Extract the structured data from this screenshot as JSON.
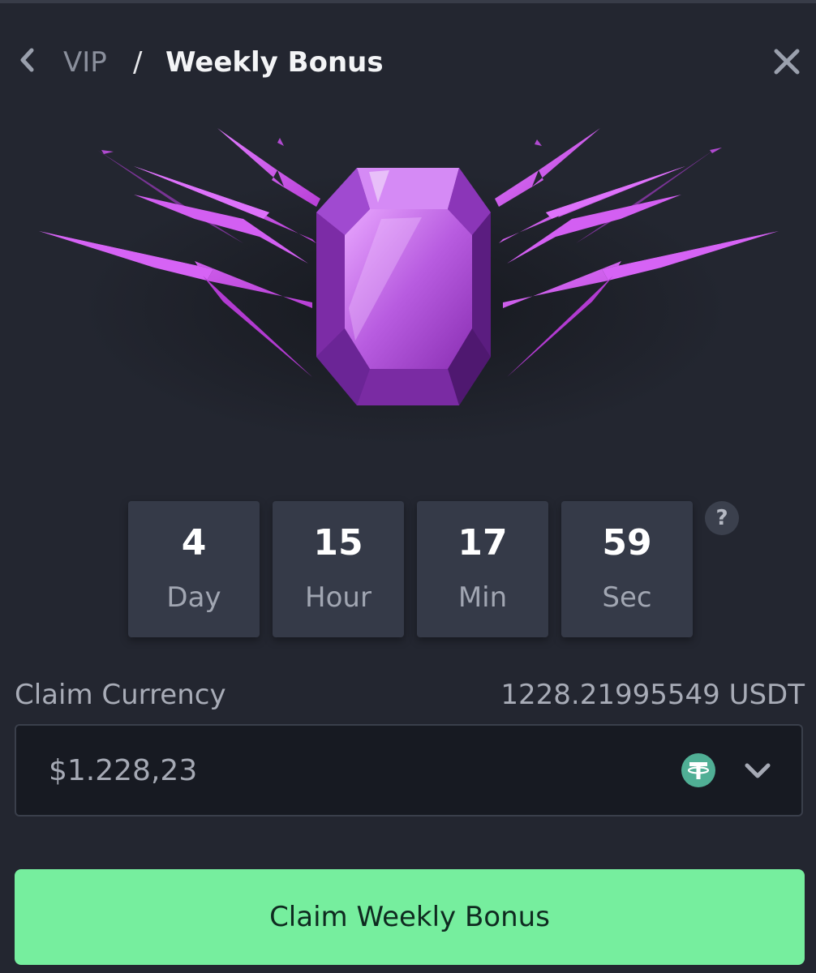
{
  "header": {
    "breadcrumb_parent": "VIP",
    "breadcrumb_separator": "/",
    "breadcrumb_current": "Weekly Bonus"
  },
  "hero": {
    "icon": "purple-gem-with-lightning-icon"
  },
  "countdown": [
    {
      "value": "4",
      "unit": "Day"
    },
    {
      "value": "15",
      "unit": "Hour"
    },
    {
      "value": "17",
      "unit": "Min"
    },
    {
      "value": "59",
      "unit": "Sec"
    }
  ],
  "help": {
    "label": "?"
  },
  "claim": {
    "label": "Claim Currency",
    "amount": "1228.21995549 USDT",
    "field_value": "$1.228,23",
    "currency_icon": "tether-usdt-icon"
  },
  "cta": {
    "label": "Claim Weekly Bonus"
  },
  "colors": {
    "background": "#232630",
    "panel": "#353a48",
    "field": "#171a22",
    "accent_green": "#76ee9e",
    "gem_purple": "#c04ae0",
    "tether_green": "#50af95"
  }
}
